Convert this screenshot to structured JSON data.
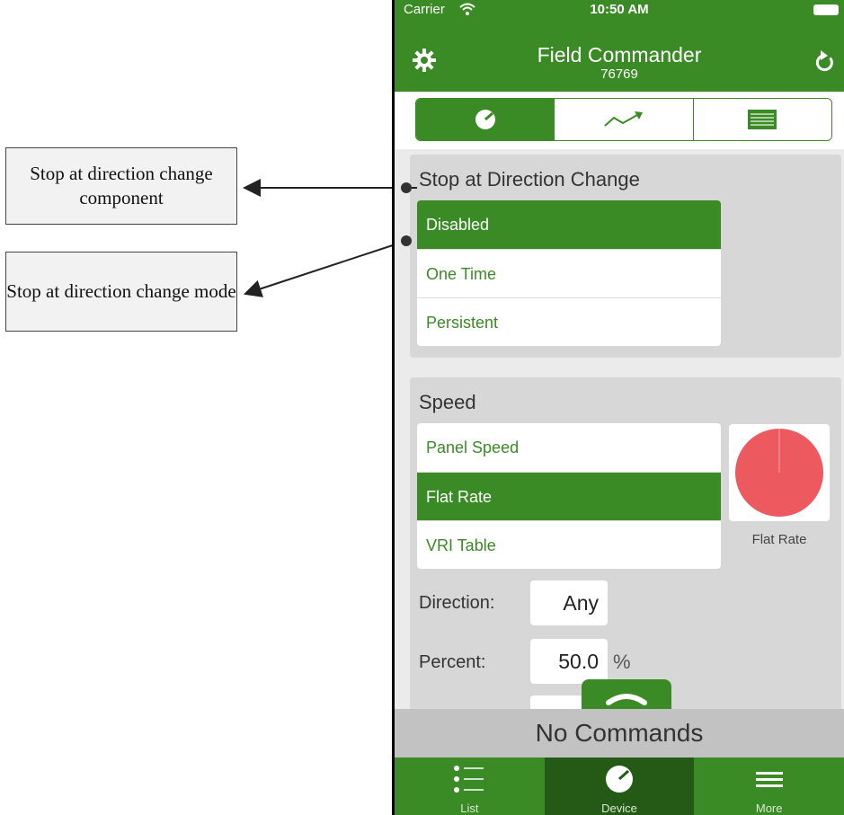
{
  "annotations": [
    {
      "label": "Stop at direction change component"
    },
    {
      "label": "Stop at direction change mode"
    }
  ],
  "status_bar": {
    "carrier": "Carrier",
    "time": "10:50 AM"
  },
  "nav": {
    "title": "Field Commander",
    "subtitle": "76769",
    "left_icon": "gear-icon",
    "right_icon": "refresh-icon"
  },
  "segmented": [
    {
      "icon": "gauge-icon",
      "selected": true
    },
    {
      "icon": "trend-icon",
      "selected": false
    },
    {
      "icon": "table-icon",
      "selected": false
    }
  ],
  "stop_section": {
    "title": "Stop at Direction Change",
    "options": [
      "Disabled",
      "One Time",
      "Persistent"
    ],
    "selected": "Disabled"
  },
  "speed_section": {
    "title": "Speed",
    "options": [
      "Panel Speed",
      "Flat Rate",
      "VRI Table"
    ],
    "selected": "Flat Rate",
    "pie_label": "Flat Rate",
    "direction_label": "Direction:",
    "direction_value": "Any",
    "percent_label": "Percent:",
    "percent_value": "50.0",
    "percent_unit": "%"
  },
  "commands_bar": {
    "text": "No Commands"
  },
  "tabbar": [
    {
      "label": "List",
      "icon": "list-icon",
      "active": false
    },
    {
      "label": "Device",
      "icon": "gauge-icon",
      "active": true
    },
    {
      "label": "More",
      "icon": "menu-icon",
      "active": false
    }
  ],
  "colors": {
    "primary_green": "#3a8a25",
    "dark_green": "#245a16",
    "pie_red": "#ec5a60"
  }
}
